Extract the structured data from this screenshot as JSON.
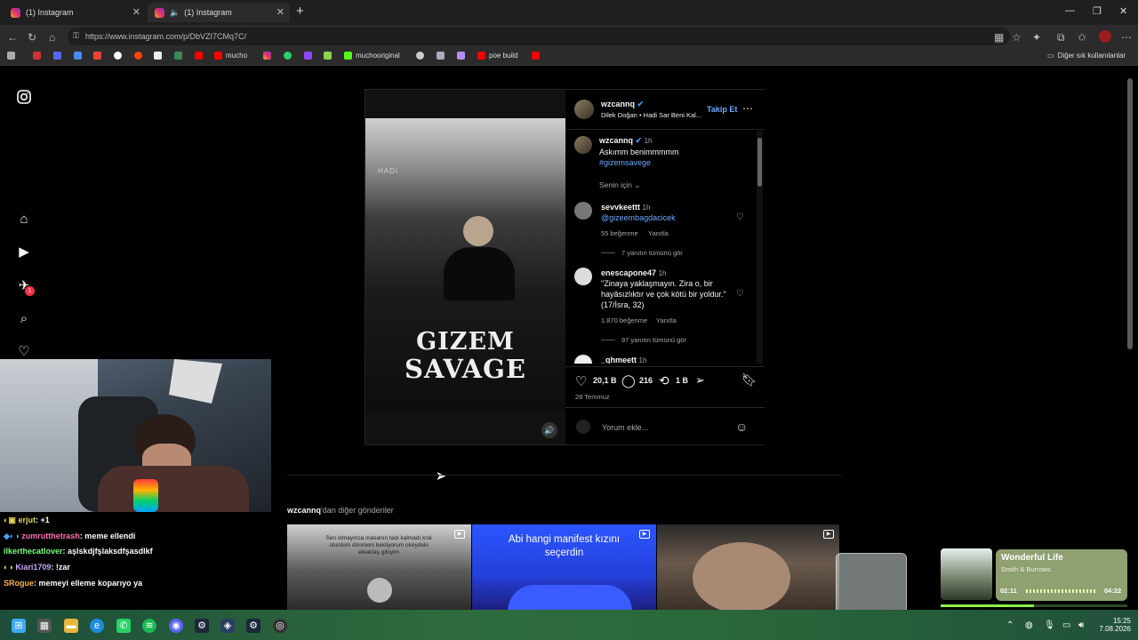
{
  "browser": {
    "tabs": [
      {
        "title": "(1) Instagram"
      },
      {
        "title": "(1) Instagram"
      }
    ],
    "new_tab": "+",
    "url": "https://www.instagram.com/p/DbVZI7CMq7C/",
    "bookmarks": [
      "mucho",
      "muchooriginal",
      "poe build"
    ],
    "other_bookmarks": "Diğer sık kullanılanlar"
  },
  "post": {
    "author": "wzcannq",
    "audio": "Dilek Doğan • Hadi Sar Beni Kal...",
    "follow": "Takip Et",
    "caption_time": "1h",
    "caption": "Askımm benimmmmm",
    "hashtag": "#gizemsavege",
    "sort": "Senin için",
    "media_text_small": "HADI",
    "media_text_1": "GIZEM",
    "media_text_2": "SAVAGE",
    "comments": [
      {
        "user": "sevvkeettt",
        "time": "1h",
        "text": "@gizeembagdacicek",
        "likes": "55 beğenme",
        "reply": "Yanıtla",
        "more": "7 yanıtın tümünü gör"
      },
      {
        "user": "enescapone47",
        "time": "1h",
        "text": "\"Zinaya yaklaşmayın. Zira o, bir hayâsızlıktır ve çok kötü bir yoldur.\" (17/İsra, 32)",
        "likes": "1.870 beğenme",
        "reply": "Yanıtla",
        "more": "97 yanıtın tümünü gör"
      },
      {
        "user": "_qhmeett",
        "time": "1h"
      }
    ],
    "likes": "20,1 B",
    "comment_count": "216",
    "shares": "1 B",
    "date": "28 Temmuz",
    "comment_placeholder": "Yorum ekle..."
  },
  "more_posts": {
    "heading_user": "wzcannq",
    "heading_rest": "'dan diğer gönderiler",
    "thumb1_text": "Sen olmayınca masanın tadı kalmadı kral oturdum dönmeni bekliyorum okeydeki ekiaktaş gibiyim",
    "thumb2_text": "Abi hangi manifest kızını seçerdin"
  },
  "chat": [
    {
      "user": "erjut",
      "msg": ": +1",
      "color": "#e8d24a"
    },
    {
      "user": "zumrutthetrash",
      "msg": ": meme ellendi",
      "color": "#ff6fb0"
    },
    {
      "user": "ilkerthecatlover",
      "msg": ": aşlskdjfşlaksdfşasdlkf",
      "color": "#7dff7d"
    },
    {
      "user": "Kiari1709",
      "msg": ": !zar",
      "color": "#c8a8ff"
    },
    {
      "user": "SRogue",
      "msg": ": memeyi elleme koparıyo ya",
      "color": "#ffb347"
    }
  ],
  "music": {
    "title": "Wonderful Life",
    "artist": "Smith & Burrows",
    "elapsed": "02:11",
    "total": "04:22",
    "progress": 0.5
  },
  "nav_badge": "1",
  "taskbar": {
    "time": "15:25",
    "date": "7.08.2026"
  },
  "colors": {
    "link": "#6ea8fe",
    "follow": "#6ea8fe",
    "taskbar": "#2d6b3c"
  }
}
